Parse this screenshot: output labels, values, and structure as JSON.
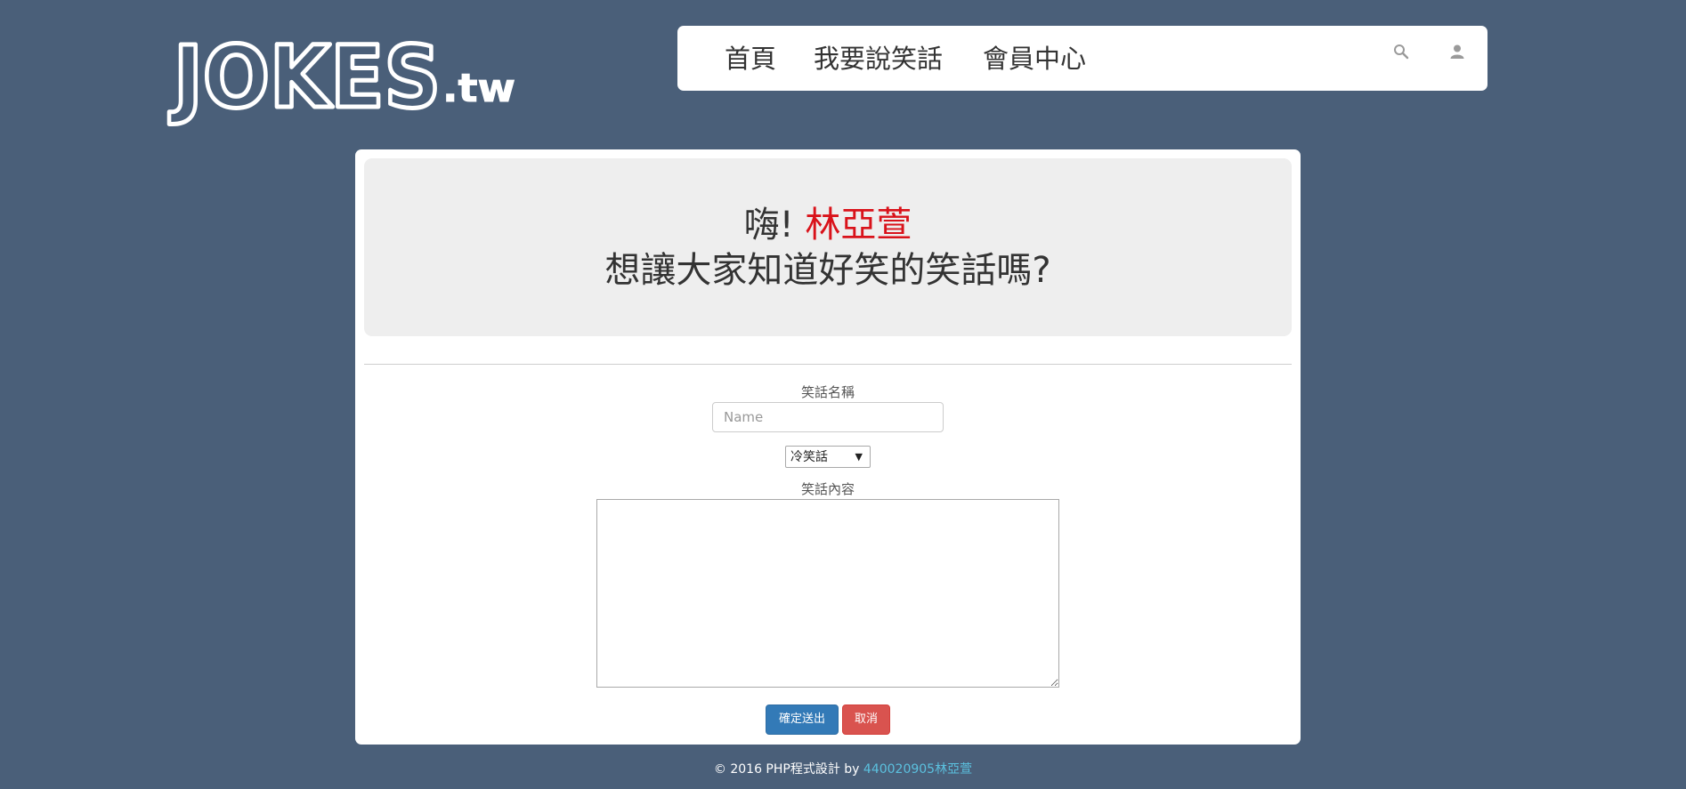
{
  "logo": {
    "main": "JOKES",
    "suffix": ".tw"
  },
  "nav": {
    "items": [
      {
        "label": "首頁"
      },
      {
        "label": "我要說笑話"
      },
      {
        "label": "會員中心"
      }
    ],
    "icons": [
      "search-icon",
      "user-icon"
    ]
  },
  "greeting": {
    "prefix": "嗨! ",
    "name": "林亞萱",
    "question": "想讓大家知道好笑的笑話嗎?"
  },
  "form": {
    "title_label": "笑話名稱",
    "title_placeholder": "Name",
    "title_value": "",
    "category_selected": "冷笑話",
    "content_label": "笑話內容",
    "content_value": "",
    "submit_label": "確定送出",
    "cancel_label": "取消"
  },
  "footer": {
    "text": "© 2016 PHP程式設計 by ",
    "author": "440020905林亞萱"
  },
  "colors": {
    "background": "#4a5f79",
    "accent_name": "#d9121a",
    "primary": "#337ab7",
    "danger": "#d9534f",
    "footer_link": "#5bc0de"
  }
}
